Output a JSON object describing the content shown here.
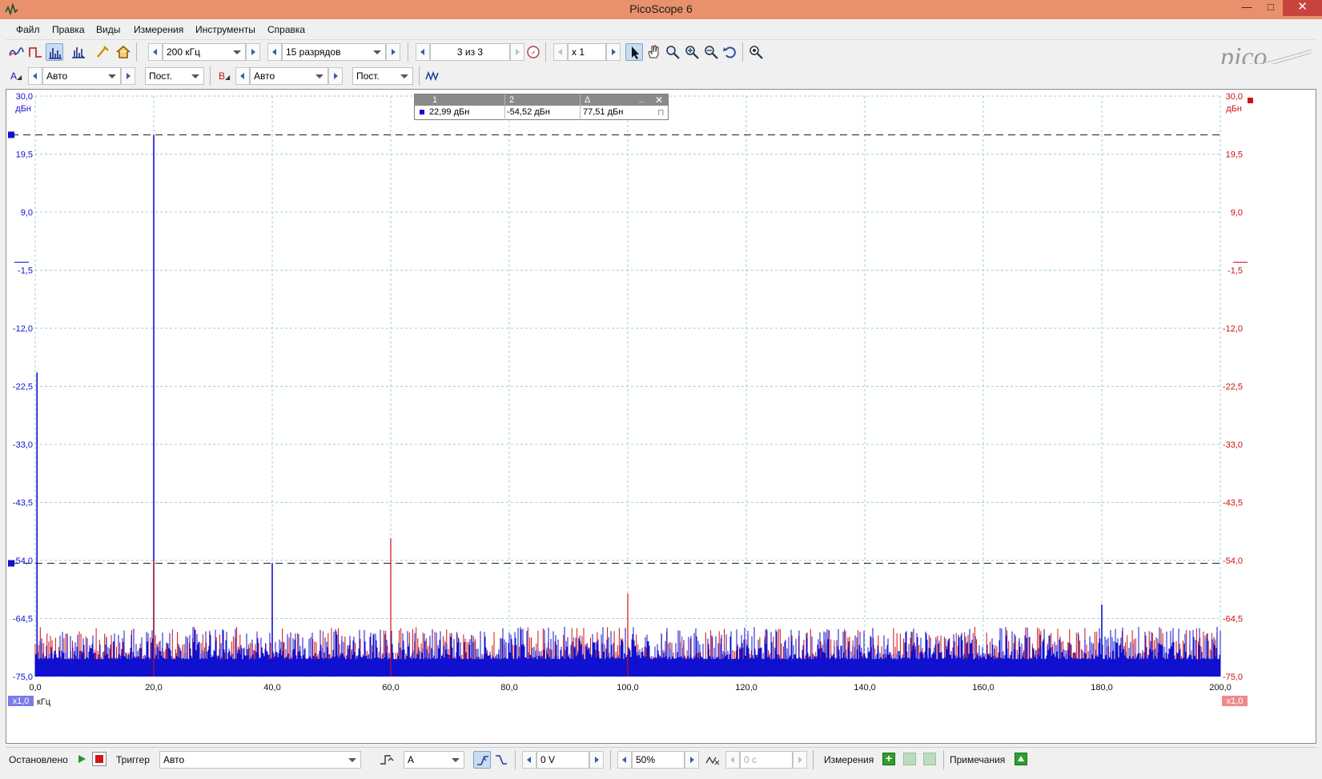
{
  "window": {
    "title": "PicoScope 6",
    "min_glyph": "—",
    "max_glyph": "□",
    "close_glyph": "✕"
  },
  "menu": [
    "Файл",
    "Правка",
    "Виды",
    "Измерения",
    "Инструменты",
    "Справка"
  ],
  "toolbar": {
    "timebase": "200 кГц",
    "resolution": "15 разрядов",
    "buffer": "3 из 3",
    "zoom": "x 1"
  },
  "channel_a": {
    "label": "A",
    "range": "Авто",
    "coupling": "Пост.",
    "color": "#1010d0"
  },
  "channel_b": {
    "label": "B",
    "range": "Авто",
    "coupling": "Пост.",
    "color": "#d01010"
  },
  "cursor_table": {
    "col1": "1",
    "col2": "2",
    "col_delta": "Δ",
    "value1": "22,99 дБн",
    "value2": "-54,52 дБн",
    "delta": "77,51 дБн"
  },
  "plot": {
    "y_unit_left": "дБн",
    "x_unit": "кГц",
    "scale_left": "x1,0",
    "scale_right": "x1,0",
    "y_ticks": [
      "30,0",
      "19,5",
      "9,0",
      "-1,5",
      "-12,0",
      "-22,5",
      "-33,0",
      "-43,5",
      "-54,0",
      "-64,5",
      "-75,0"
    ],
    "x_ticks": [
      "0,0",
      "20,0",
      "40,0",
      "60,0",
      "80,0",
      "100,0",
      "120,0",
      "140,0",
      "160,0",
      "180,0",
      "200,0"
    ]
  },
  "chart_data": {
    "type": "line",
    "title": "",
    "xlabel": "кГц",
    "ylabel": "дБн",
    "xlim": [
      0,
      200
    ],
    "ylim": [
      -75,
      30
    ],
    "grid": true,
    "noise_floor_db": [
      -75,
      -66
    ],
    "cursor_levels_db": [
      22.99,
      -54.52
    ],
    "series": [
      {
        "name": "A",
        "color": "#1010d0",
        "peaks": [
          {
            "x": 0.3,
            "y": -20
          },
          {
            "x": 20.0,
            "y": 22.99
          },
          {
            "x": 40.0,
            "y": -54.5
          },
          {
            "x": 180.0,
            "y": -62
          }
        ]
      },
      {
        "name": "B",
        "color": "#d01010",
        "peaks": [
          {
            "x": 20.0,
            "y": -54
          },
          {
            "x": 60.0,
            "y": -50
          },
          {
            "x": 100.0,
            "y": -60
          }
        ]
      }
    ]
  },
  "status": {
    "state": "Остановлено",
    "trigger_label": "Триггер",
    "trigger_mode": "Авто",
    "trigger_source": "A",
    "threshold": "0 V",
    "pretrigger": "50%",
    "delay": "0 с",
    "measurements": "Измерения",
    "notes": "Примечания"
  }
}
